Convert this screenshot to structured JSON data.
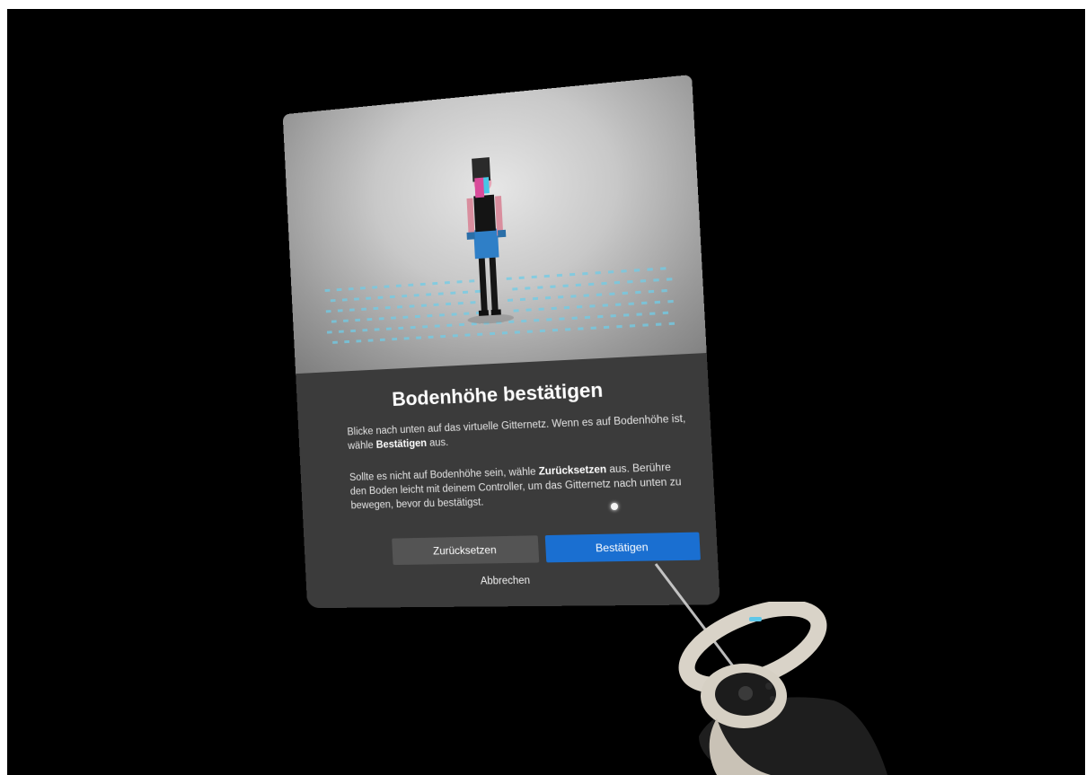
{
  "dialog": {
    "title": "Bodenhöhe bestätigen",
    "paragraph1_a": "Blicke nach unten auf das virtuelle Gitternetz. Wenn es auf Bodenhöhe ist, wähle ",
    "paragraph1_bold": "Bestätigen",
    "paragraph1_b": " aus.",
    "paragraph2_a": "Sollte es nicht auf Bodenhöhe sein, wähle ",
    "paragraph2_bold": "Zurücksetzen",
    "paragraph2_b": " aus. Berühre den Boden leicht mit deinem Controller, um das Gitternetz nach unten zu bewegen, bevor du bestätigst.",
    "reset_label": "Zurücksetzen",
    "confirm_label": "Bestätigen",
    "cancel_label": "Abbrechen"
  },
  "colors": {
    "background": "#000000",
    "panel": "#3b3b3b",
    "primary_button": "#1a6fd1",
    "secondary_button": "#545454",
    "grid_dots": "#5fc7e8"
  },
  "icons": {
    "pointer": "pointer-dot-icon",
    "controller": "vr-controller-icon"
  }
}
